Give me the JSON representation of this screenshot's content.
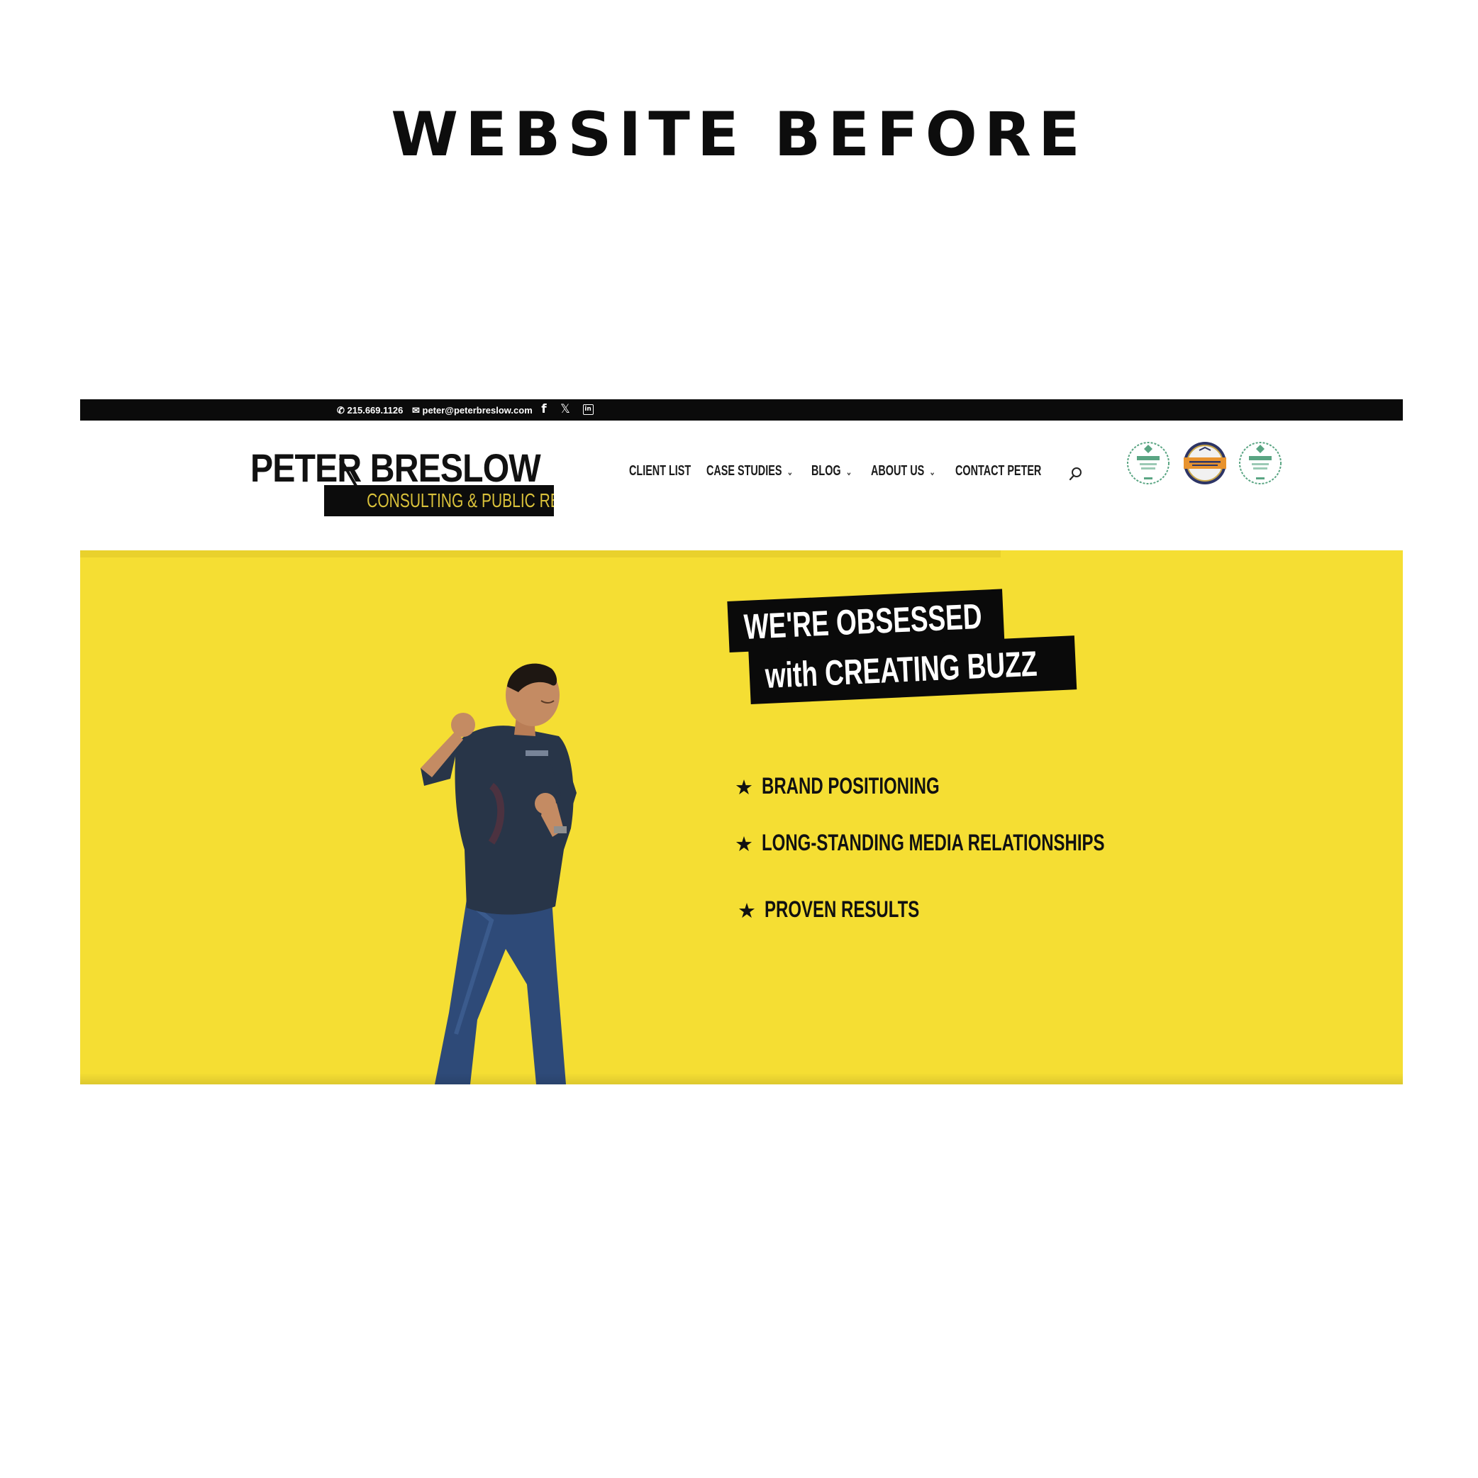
{
  "heading": "WEBSITE BEFORE",
  "topbar": {
    "phone": "215.669.1126",
    "email": "peter@peterbreslow.com",
    "social_icons": [
      "facebook-icon",
      "x-icon",
      "linkedin-icon"
    ]
  },
  "logo": {
    "name": "PETER BRESLOW",
    "tagline": "CONSULTING & PUBLIC RELATIONS"
  },
  "nav": {
    "items": [
      {
        "label": "CLIENT LIST",
        "has_dropdown": false
      },
      {
        "label": "CASE STUDIES",
        "has_dropdown": true
      },
      {
        "label": "BLOG",
        "has_dropdown": true
      },
      {
        "label": "ABOUT US",
        "has_dropdown": true
      },
      {
        "label": "CONTACT PETER",
        "has_dropdown": false
      }
    ],
    "search_icon": "search-icon"
  },
  "badges": [
    "expertise-badge",
    "award-badge",
    "expertise-badge"
  ],
  "hero": {
    "headline_line1": "WE'RE OBSESSED",
    "headline_line2": "with CREATING BUZZ",
    "bullets": [
      "BRAND POSITIONING",
      "LONG-STANDING MEDIA RELATIONSHIPS",
      "PROVEN RESULTS"
    ]
  },
  "colors": {
    "hero_yellow": "#f5de33",
    "topbar_black": "#0b0b0b",
    "logo_gold": "#d9c13a",
    "badge_green": "#5aa583",
    "badge_orange": "#e8932e",
    "badge_navy": "#2d3566"
  }
}
